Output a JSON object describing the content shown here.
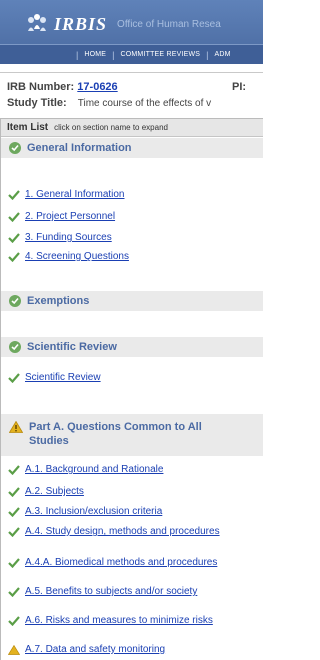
{
  "header": {
    "logo_text": "IRBIS",
    "logo_subtitle": "Office of Human Resea",
    "nav": [
      "HOME",
      "COMMITTEE REVIEWS",
      "ADM"
    ]
  },
  "info": {
    "irb_label": "IRB Number:",
    "irb_number": "17-0626",
    "pi_label": "PI:",
    "study_title_label": "Study Title:",
    "study_title": "Time course of the effects of v"
  },
  "panel": {
    "title": "Item List",
    "hint": "click on section name to expand"
  },
  "sections": {
    "general": {
      "title": "General Information",
      "items": [
        "1. General Information",
        "2. Project Personnel",
        "3. Funding Sources",
        "4. Screening Questions"
      ]
    },
    "exemptions": {
      "title": "Exemptions"
    },
    "scientific": {
      "title": "Scientific Review",
      "items": [
        "Scientific Review"
      ]
    },
    "partA": {
      "title": "Part A. Questions Common to All Studies",
      "items": [
        "A.1. Background and Rationale",
        "A.2. Subjects",
        "A.3. Inclusion/exclusion criteria",
        "A.4. Study design, methods and procedures",
        "A.4.A. Biomedical methods and procedures",
        "A.5. Benefits to subjects and/or society",
        "A.6. Risks and measures to minimize risks",
        "A.7. Data and safety monitoring"
      ]
    }
  },
  "colors": {
    "banner": "#5f82b9",
    "link": "#1a3fb3",
    "section_title": "#4b6aa3",
    "check_green": "#6ea85f",
    "warning": "#e3b21f"
  }
}
